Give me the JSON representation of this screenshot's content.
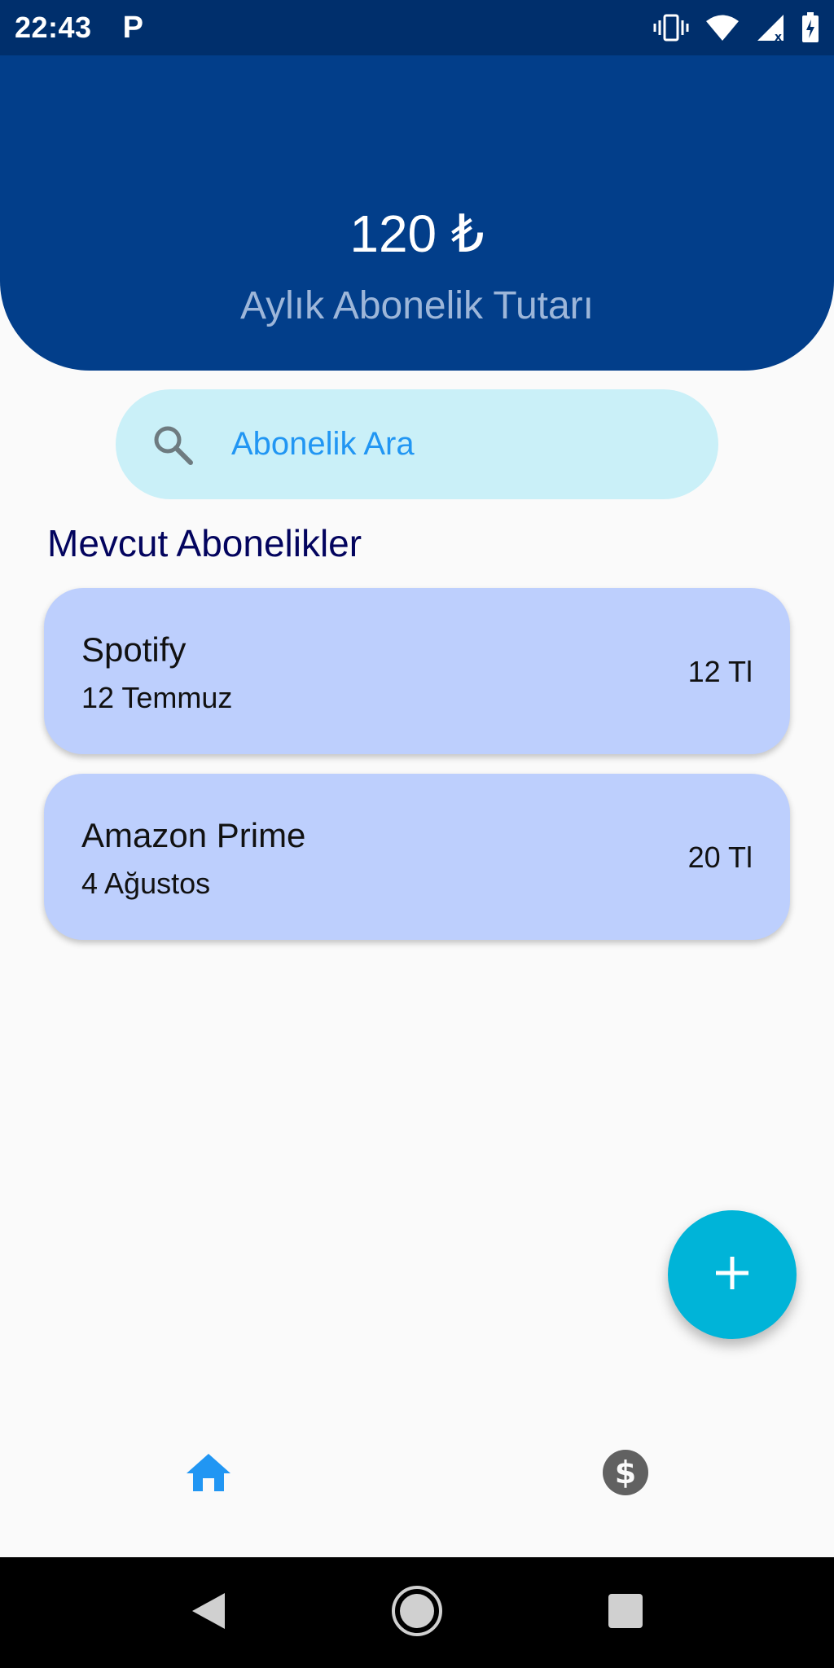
{
  "status_bar": {
    "time": "22:43",
    "notification_glyph": "P",
    "icons": [
      "vibrate-icon",
      "wifi-icon",
      "signal-icon",
      "battery-icon"
    ]
  },
  "header": {
    "total_amount": "120 ₺",
    "caption": "Aylık Abonelik Tutarı"
  },
  "search": {
    "placeholder": "Abonelik Ara",
    "icon": "search-icon"
  },
  "section_title": "Mevcut Abonelikler",
  "subscriptions": [
    {
      "name": "Spotify",
      "date": "12 Temmuz",
      "price": "12 Tl"
    },
    {
      "name": "Amazon Prime",
      "date": "4 Ağustos",
      "price": "20 Tl"
    }
  ],
  "fab": {
    "icon": "plus-icon"
  },
  "bottom_nav": [
    {
      "icon": "home-icon",
      "active": true
    },
    {
      "icon": "dollar-icon",
      "active": false
    }
  ],
  "colors": {
    "status_bar": "#002f6c",
    "header": "#023e8a",
    "search_bg": "#caf0f8",
    "card_bg": "#bdcffd",
    "fab": "#00b4d8",
    "accent": "#2196f3",
    "title": "#03045e"
  }
}
